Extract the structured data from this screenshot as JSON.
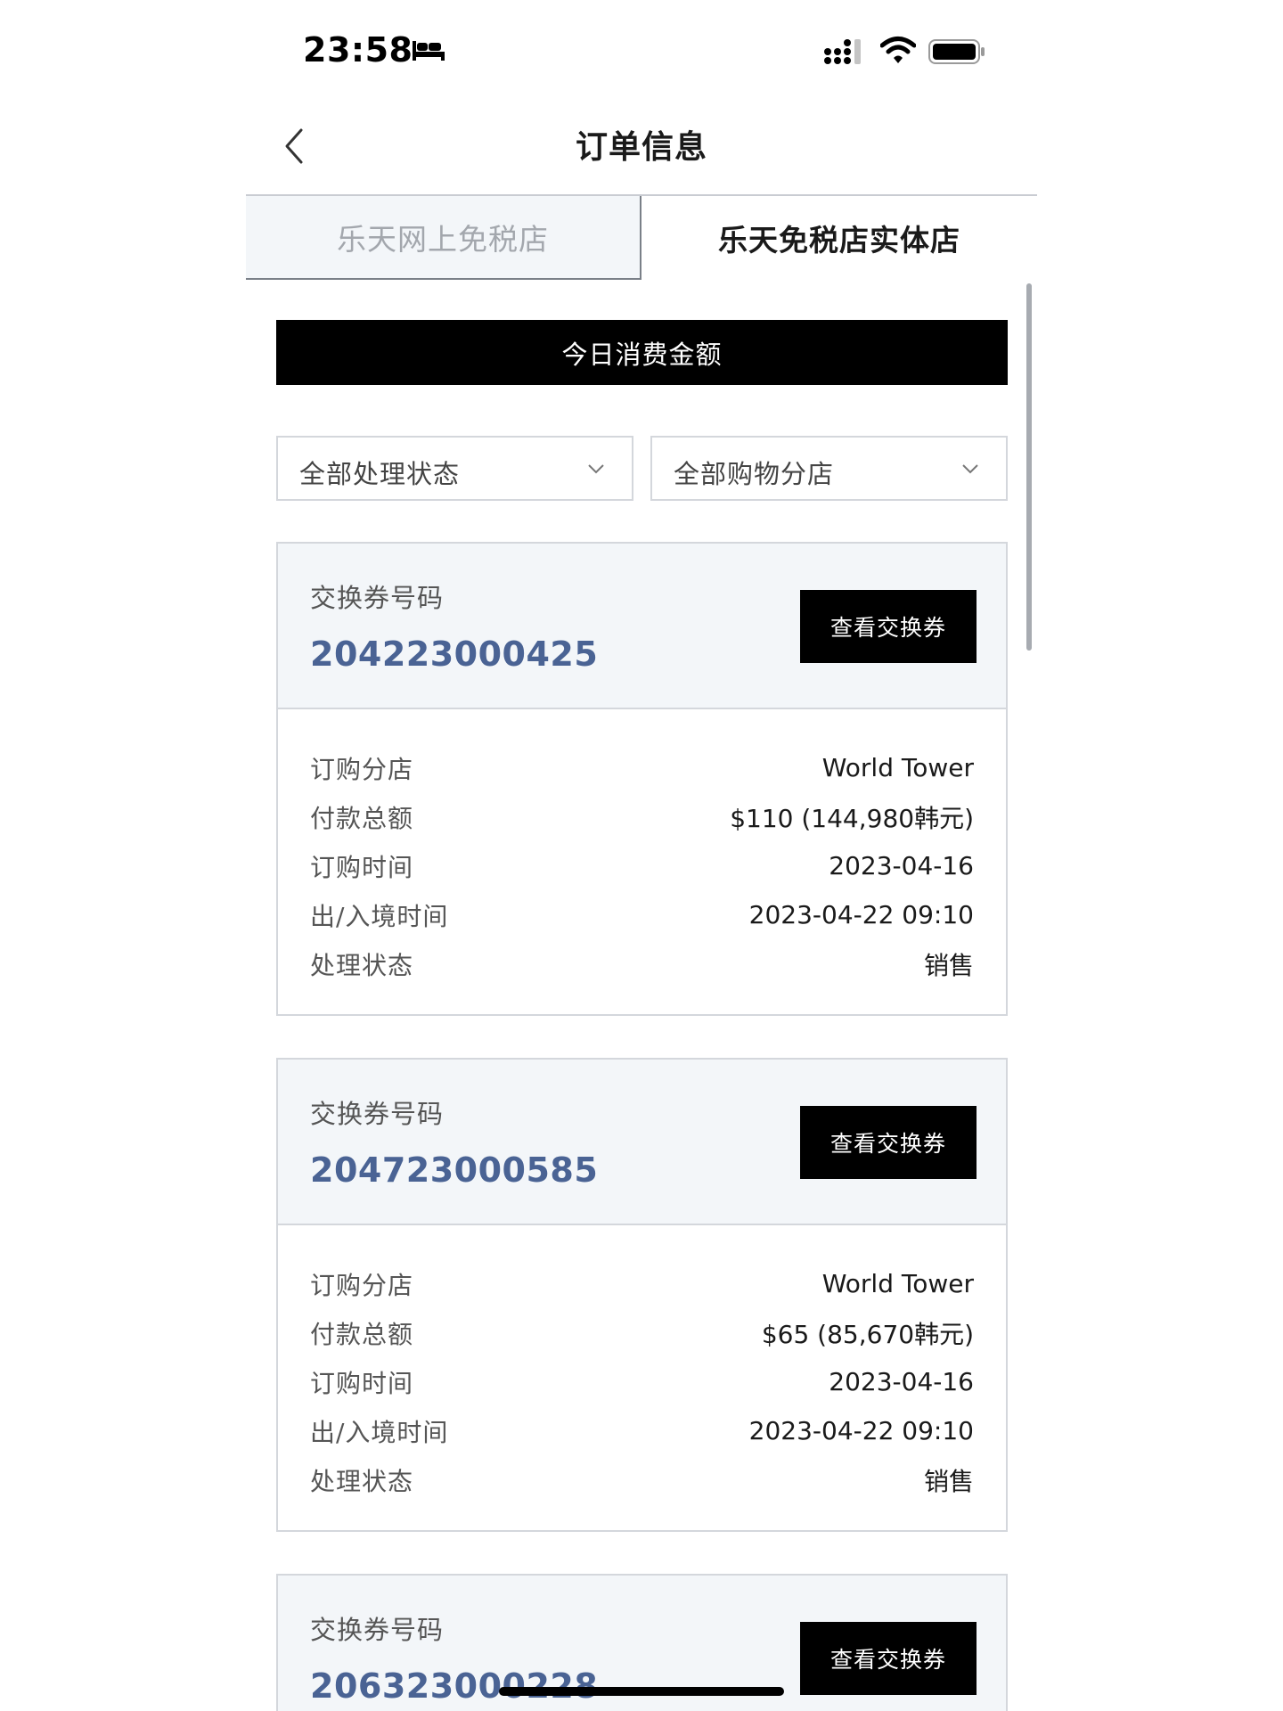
{
  "status_bar": {
    "time": "23:58"
  },
  "header": {
    "title": "订单信息"
  },
  "tabs": [
    {
      "label": "乐天网上免税店",
      "active": false
    },
    {
      "label": "乐天免税店实体店",
      "active": true
    }
  ],
  "today_bar": {
    "label": "今日消费金额"
  },
  "filters": {
    "status": "全部处理状态",
    "branch": "全部购物分店"
  },
  "orders": [
    {
      "voucher_label": "交换券号码",
      "voucher_number": "204223000425",
      "button_label": "查看交换券",
      "details": [
        {
          "key": "订购分店",
          "value": "World Tower"
        },
        {
          "key": "付款总额",
          "value": "$110 (144,980韩元)"
        },
        {
          "key": "订购时间",
          "value": "2023-04-16"
        },
        {
          "key": "出/入境时间",
          "value": "2023-04-22 09:10"
        },
        {
          "key": "处理状态",
          "value": "销售"
        }
      ]
    },
    {
      "voucher_label": "交换券号码",
      "voucher_number": "204723000585",
      "button_label": "查看交换券",
      "details": [
        {
          "key": "订购分店",
          "value": "World Tower"
        },
        {
          "key": "付款总额",
          "value": "$65 (85,670韩元)"
        },
        {
          "key": "订购时间",
          "value": "2023-04-16"
        },
        {
          "key": "出/入境时间",
          "value": "2023-04-22 09:10"
        },
        {
          "key": "处理状态",
          "value": "销售"
        }
      ]
    },
    {
      "voucher_label": "交换券号码",
      "voucher_number": "206323000228",
      "button_label": "查看交换券"
    }
  ],
  "colors": {
    "accent_number": "#4a6394",
    "button_bg": "#000000",
    "card_head_bg": "#f3f6f9"
  }
}
